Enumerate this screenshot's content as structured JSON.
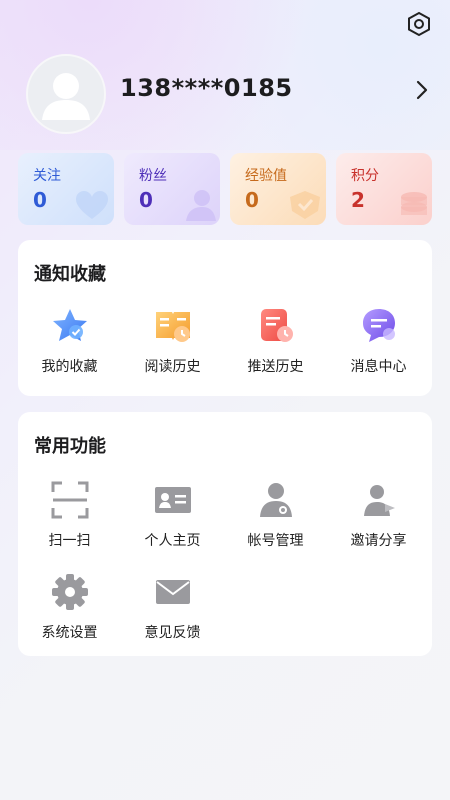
{
  "profile": {
    "phone": "138****0185"
  },
  "stats": [
    {
      "label": "关注",
      "value": "0",
      "color": "#2f5bd6",
      "bg": "#dbe8fc"
    },
    {
      "label": "粉丝",
      "value": "0",
      "color": "#4e2fb8",
      "bg": "#e7e1fb"
    },
    {
      "label": "经验值",
      "value": "0",
      "color": "#c66a1c",
      "bg": "#fde9d3"
    },
    {
      "label": "积分",
      "value": "2",
      "color": "#c8322c",
      "bg": "#fde0dd"
    }
  ],
  "notice_card": {
    "title": "通知收藏",
    "items": [
      {
        "label": "我的收藏",
        "icon": "star-icon"
      },
      {
        "label": "阅读历史",
        "icon": "book-clock-icon"
      },
      {
        "label": "推送历史",
        "icon": "doc-clock-icon"
      },
      {
        "label": "消息中心",
        "icon": "chat-bubble-icon"
      }
    ]
  },
  "common_card": {
    "title": "常用功能",
    "items": [
      {
        "label": "扫一扫",
        "icon": "scan-icon"
      },
      {
        "label": "个人主页",
        "icon": "id-card-icon"
      },
      {
        "label": "帐号管理",
        "icon": "user-gear-icon"
      },
      {
        "label": "邀请分享",
        "icon": "user-share-icon"
      },
      {
        "label": "系统设置",
        "icon": "gear-icon"
      },
      {
        "label": "意见反馈",
        "icon": "mail-icon"
      }
    ]
  }
}
